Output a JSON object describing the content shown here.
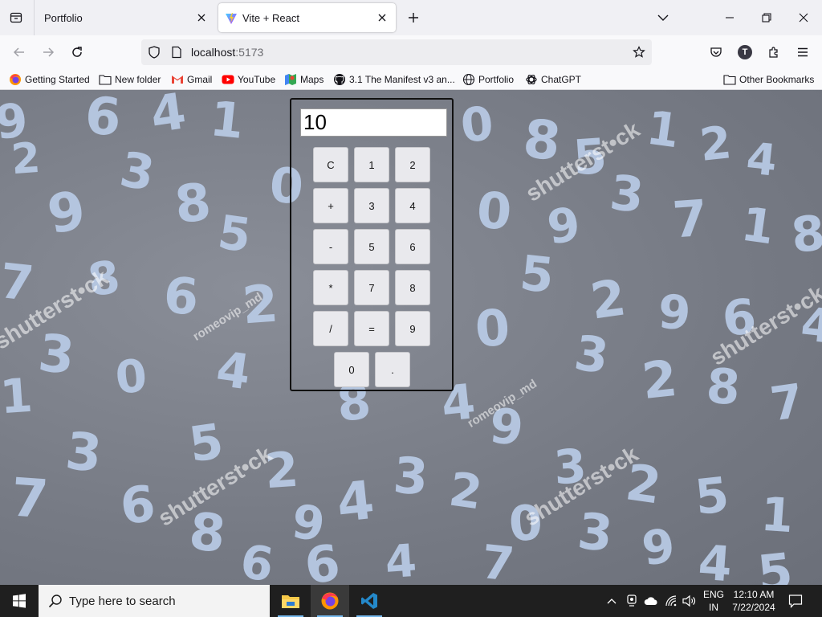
{
  "browser": {
    "tabs": [
      {
        "label": "Portfolio",
        "active": false
      },
      {
        "label": "Vite + React",
        "active": true
      }
    ],
    "url_host": "localhost",
    "url_port": ":5173",
    "bookmarks": [
      {
        "label": "Getting Started",
        "icon": "firefox-icon"
      },
      {
        "label": "New folder",
        "icon": "folder-icon"
      },
      {
        "label": "Gmail",
        "icon": "gmail-icon"
      },
      {
        "label": "YouTube",
        "icon": "youtube-icon"
      },
      {
        "label": "Maps",
        "icon": "maps-icon"
      },
      {
        "label": "3.1 The Manifest v3 an...",
        "icon": "github-icon"
      },
      {
        "label": "Portfolio",
        "icon": "globe-icon"
      },
      {
        "label": "ChatGPT",
        "icon": "chatgpt-icon"
      }
    ],
    "other_bookmarks": "Other Bookmarks",
    "profile_initial": "T"
  },
  "calculator": {
    "display_value": "10",
    "keys": [
      "C",
      "1",
      "2",
      "+",
      "3",
      "4",
      "-",
      "5",
      "6",
      "*",
      "7",
      "8",
      "/",
      "=",
      "9",
      "0",
      "."
    ]
  },
  "background": {
    "watermark_brand": "shutterst•ck",
    "watermark_user": "romeovip_md",
    "digits": [
      "9",
      "6",
      "4",
      "1",
      "2",
      "3",
      "8",
      "0",
      "9",
      "5",
      "7",
      "8",
      "6",
      "2",
      "3",
      "0",
      "4",
      "1",
      "3",
      "5",
      "7",
      "6",
      "8",
      "2",
      "9",
      "4",
      "3",
      "6",
      "0",
      "8",
      "5",
      "1",
      "2",
      "4",
      "0",
      "9",
      "3",
      "7",
      "1",
      "8",
      "5",
      "2",
      "9",
      "6",
      "4",
      "0",
      "3",
      "2",
      "8",
      "7",
      "9",
      "3",
      "2",
      "5",
      "1",
      "4",
      "2",
      "0",
      "3",
      "9",
      "4",
      "5",
      "7",
      "4",
      "6",
      "8"
    ]
  },
  "taskbar": {
    "search_placeholder": "Type here to search",
    "apps": [
      "file-explorer-icon",
      "firefox-icon",
      "vscode-icon"
    ],
    "lang_top": "ENG",
    "lang_bottom": "IN",
    "time": "12:10 AM",
    "date": "7/22/2024"
  },
  "colors": {
    "accent": "#76b9ed",
    "digit": "#b9cbe6",
    "page_bg": "#7a7e88"
  }
}
